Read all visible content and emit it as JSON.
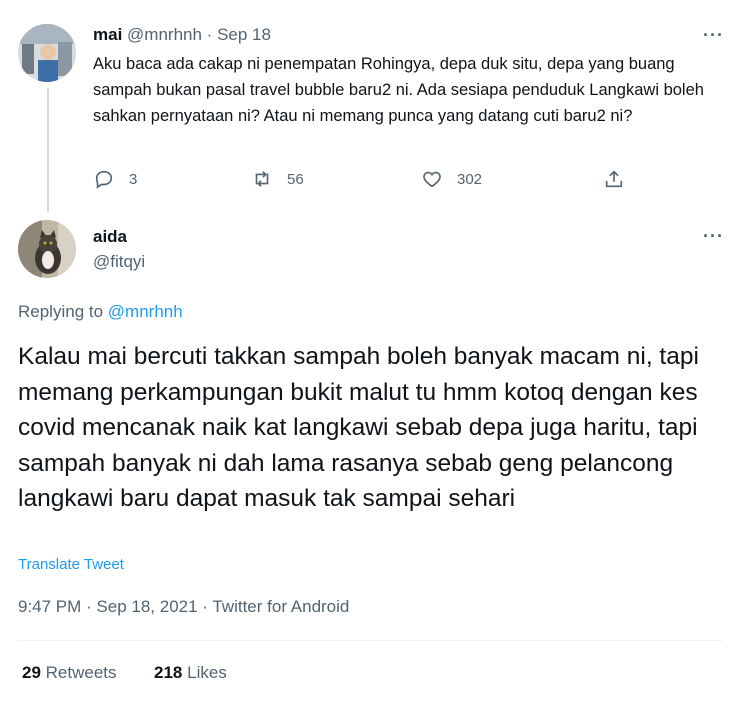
{
  "parent_tweet": {
    "display_name": "mai",
    "handle": "@mnrhnh",
    "separator": "·",
    "date": "Sep 18",
    "more": "···",
    "text": "Aku baca ada cakap ni penempatan Rohingya, depa duk situ, depa yang buang sampah bukan pasal travel bubble baru2 ni. Ada sesiapa penduduk Langkawi boleh sahkan pernyataan ni? Atau ni memang punca yang datang cuti baru2 ni?",
    "reply_count": "3",
    "retweet_count": "56",
    "like_count": "302"
  },
  "main_tweet": {
    "display_name": "aida",
    "handle": "@fitqyi",
    "more": "···",
    "replying_prefix": "Replying to ",
    "replying_handle": "@mnrhnh",
    "text": "Kalau mai bercuti takkan sampah boleh banyak macam ni, tapi memang perkampungan bukit malut tu hmm kotoq dengan kes covid mencanak naik kat langkawi sebab depa juga haritu, tapi sampah banyak ni dah lama rasanya sebab geng pelancong langkawi baru dapat masuk tak sampai sehari",
    "translate": "Translate Tweet",
    "meta": "9:47 PM · Sep 18, 2021 · Twitter for Android",
    "retweets_count": "29",
    "retweets_label": "Retweets",
    "likes_count": "218",
    "likes_label": "Likes"
  },
  "icons": {
    "reply": "reply-icon",
    "retweet": "retweet-icon",
    "like": "heart-icon",
    "share": "share-icon"
  },
  "colors": {
    "link": "#1d9bf0",
    "muted": "#536471",
    "text": "#0f1419"
  }
}
